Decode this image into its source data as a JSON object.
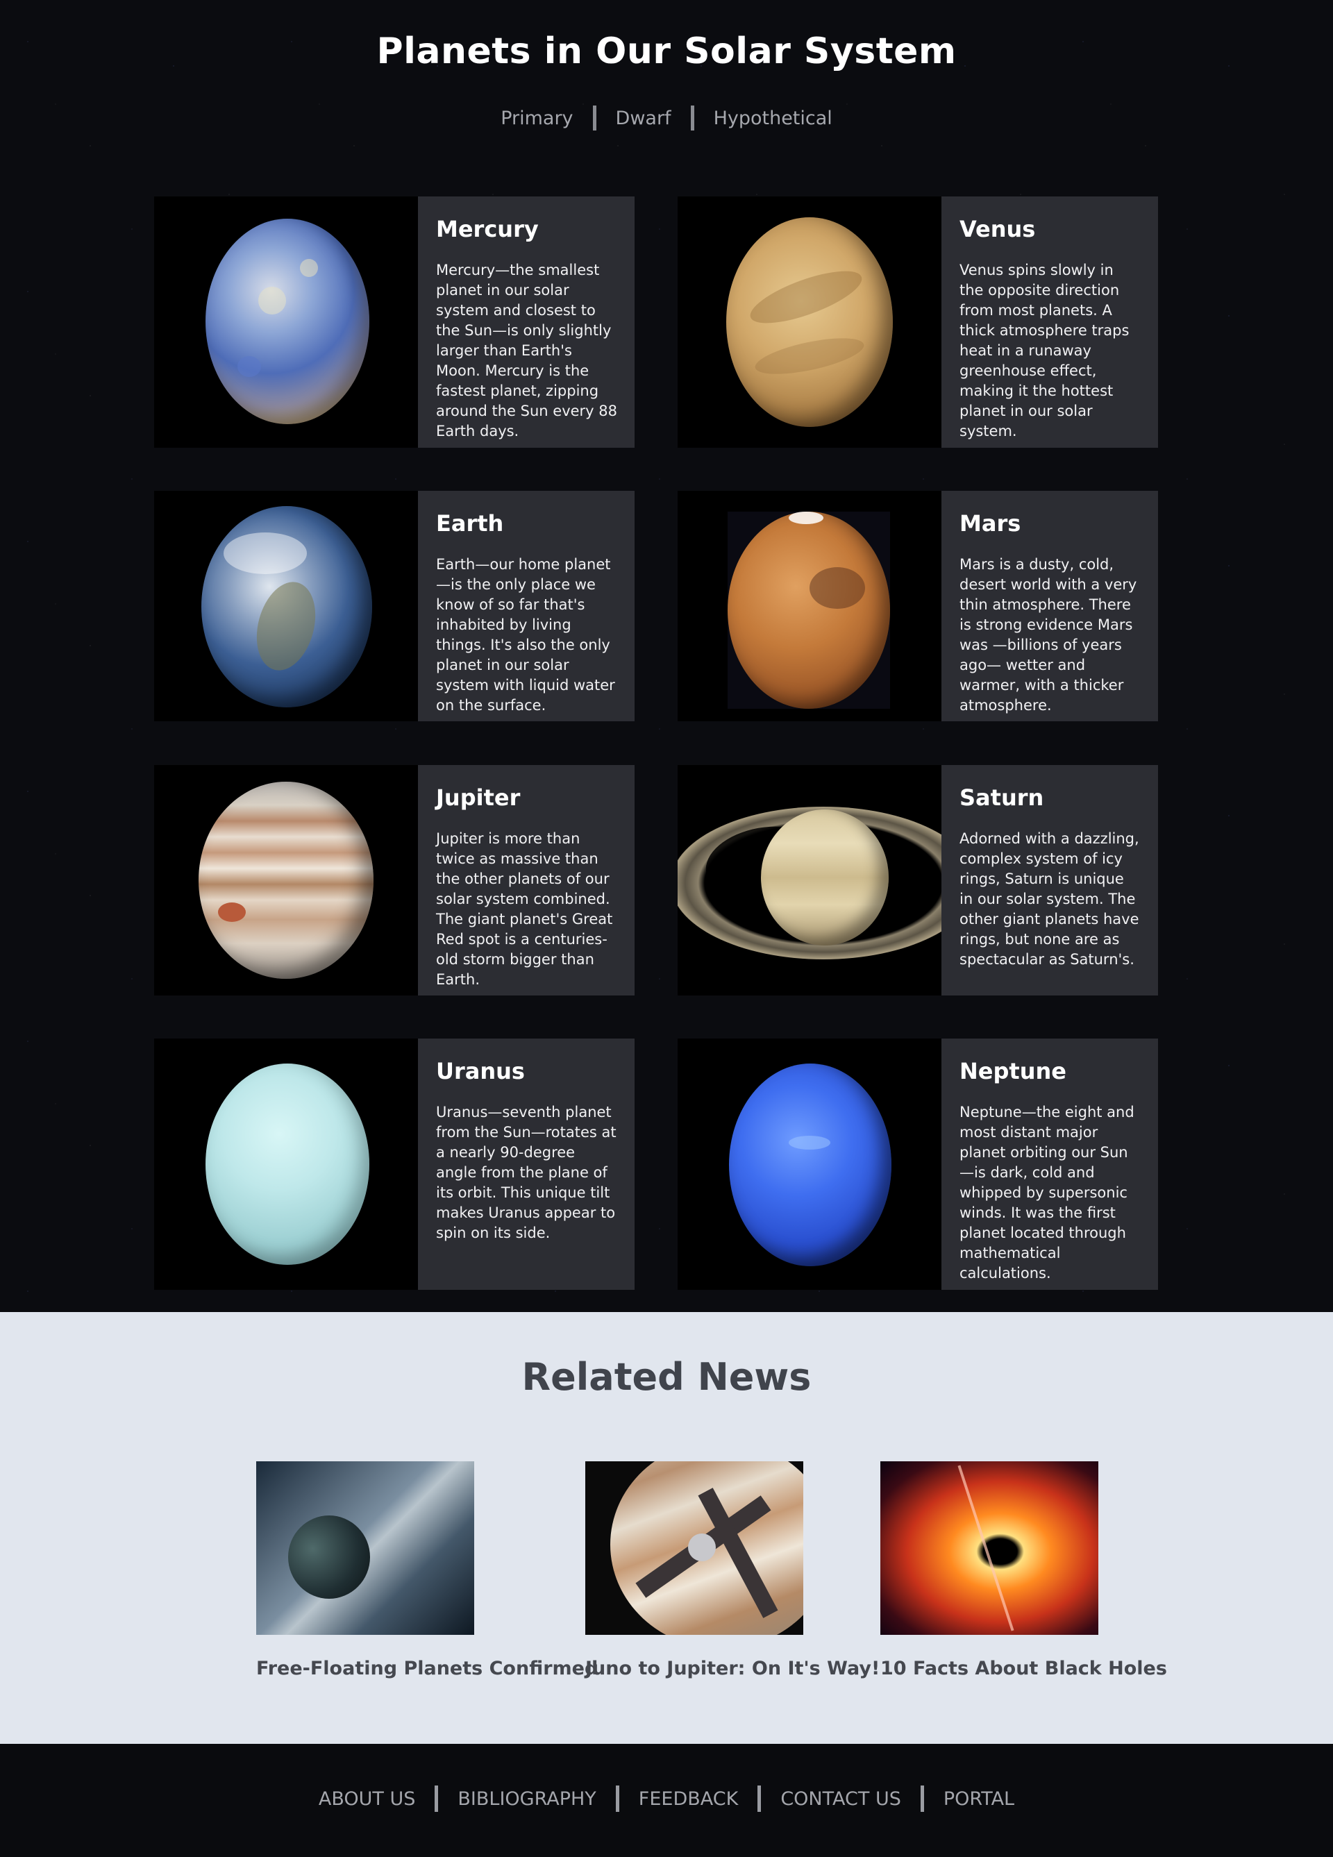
{
  "header": {
    "title": "Planets in Our Solar System",
    "filters": [
      "Primary",
      "Dwarf",
      "Hypothetical"
    ]
  },
  "planets": [
    {
      "name": "Mercury",
      "text": "Mercury—the smallest planet in our solar system and closest to the Sun—is only slightly larger than Earth's Moon. Mercury is the fastest planet, zipping around the Sun every 88 Earth days."
    },
    {
      "name": "Venus",
      "text": "Venus spins slowly in the opposite direction from most planets. A thick atmosphere traps heat in a runaway greenhouse effect, making it the hottest planet in our solar system."
    },
    {
      "name": "Earth",
      "text": "Earth—our home planet—is the only place we know of so far that's inhabited by living things. It's also the only planet in our solar system with liquid water on the surface."
    },
    {
      "name": "Mars",
      "text": "Mars is a dusty, cold, desert world with a very thin atmosphere. There is strong evidence Mars was —billions of years ago— wetter and warmer, with a thicker atmosphere."
    },
    {
      "name": "Jupiter",
      "text": "Jupiter is more than twice as massive than the other planets of our solar system combined. The giant planet's Great Red spot is a centuries-old storm bigger than Earth."
    },
    {
      "name": "Saturn",
      "text": "Adorned with a dazzling, complex system of icy rings, Saturn is unique in our solar system. The other giant planets have rings, but none are as spectacular as Saturn's."
    },
    {
      "name": "Uranus",
      "text": "Uranus—seventh planet from the Sun—rotates at a nearly 90-degree angle from the plane of its orbit. This unique tilt makes Uranus appear to spin on its side."
    },
    {
      "name": "Neptune",
      "text": "Neptune—the eight and most distant major planet orbiting our Sun—is dark, cold and whipped by supersonic winds. It was the first planet located through mathematical calculations."
    }
  ],
  "news": {
    "title": "Related News",
    "items": [
      {
        "caption": "Free-Floating Planets Confirmed"
      },
      {
        "caption": "Juno to Jupiter: On It's Way!"
      },
      {
        "caption": "10 Facts About Black Holes"
      }
    ]
  },
  "footer": {
    "links": [
      "ABOUT US",
      "BIBLIOGRAPHY",
      "FEEDBACK",
      "CONTACT US",
      "PORTAL"
    ]
  }
}
